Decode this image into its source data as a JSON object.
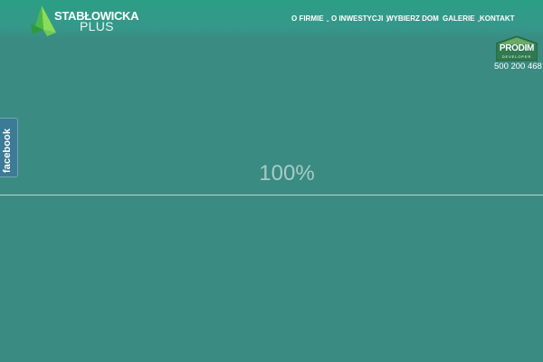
{
  "brand": {
    "line1": "STABŁOWICKA",
    "line2": "PLUS",
    "mark_icon": "green-triangle-logo-icon"
  },
  "nav": {
    "items": [
      {
        "label": "O FIRMIE",
        "has_dropdown": true
      },
      {
        "label": "O INWESTYCJI",
        "has_dropdown": true
      },
      {
        "label": "WYBIERZ DOM",
        "has_dropdown": false
      },
      {
        "label": "GALERIE",
        "has_dropdown": true
      },
      {
        "label": "KONTAKT",
        "has_dropdown": false
      }
    ],
    "dropdown_icon": "chevron-down-icon"
  },
  "developer": {
    "name": "PRODIM",
    "subtitle": "DEVELOPER",
    "phone": "500 200 468"
  },
  "social": {
    "facebook_label": "facebook"
  },
  "loader": {
    "percent_label": "100%",
    "progress": 1.0
  },
  "colors": {
    "background": "#3a8b81",
    "header_top": "#2c9f85",
    "logo_green": "#7ed957",
    "developer_green": "#2f7a4e",
    "facebook_tab": "#3c7a96",
    "loader_text": "#a9cbc5"
  }
}
